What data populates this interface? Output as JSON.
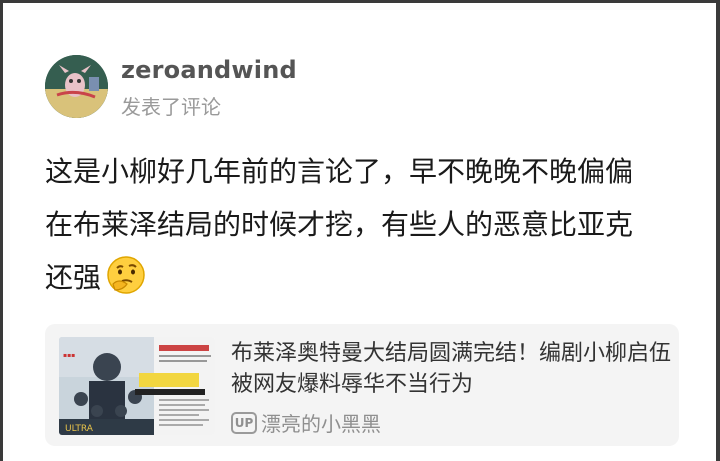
{
  "post": {
    "username": "zeroandwind",
    "action": "发表了评论",
    "content_lines": [
      "这是小柳好几年前的言论了，早不晚晚不晚偏偏",
      "在布莱泽结局的时候才挖，有些人的恶意比亚克",
      "还强"
    ],
    "emoji": "thinking-face-emoji"
  },
  "link_card": {
    "title": "布莱泽奥特曼大结局圆满完结！编剧小柳启伍被网友爆料辱华不当行为",
    "source_badge": "UP",
    "source_name": "漂亮的小黑黑"
  }
}
